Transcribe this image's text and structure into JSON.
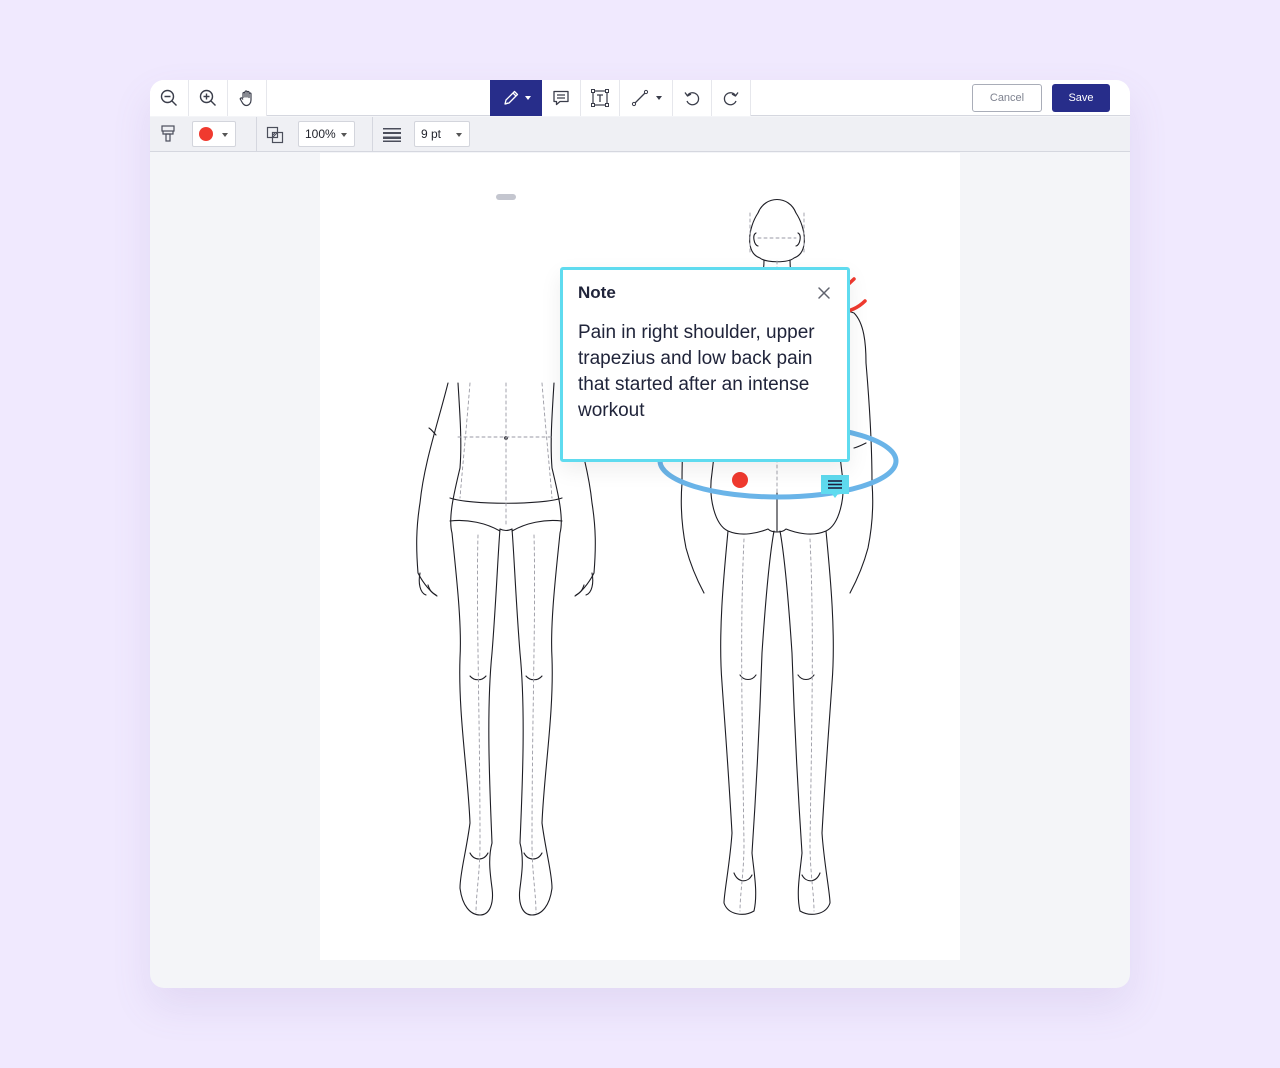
{
  "toolbar": {
    "zoom_out_icon": "zoom-out-icon",
    "zoom_in_icon": "zoom-in-icon",
    "pan_icon": "hand-icon",
    "pen_icon": "pen-icon",
    "comment_icon": "comment-icon",
    "text_box_icon": "text-box-icon",
    "line_icon": "line-icon",
    "undo_icon": "undo-icon",
    "redo_icon": "redo-icon",
    "cancel_label": "Cancel",
    "save_label": "Save"
  },
  "format_bar": {
    "stroke_color": "#f03a2f",
    "zoom_value": "100%",
    "line_weight_value": "9 pt"
  },
  "note": {
    "title": "Note",
    "body": "Pain in right shoulder, upper trapezius and low back pain that started after an intense workout"
  },
  "colors": {
    "accent": "#272d8a",
    "note_border": "#5fdbef",
    "annotation_red": "#f03a2f",
    "annotation_blue": "#6ab4e8",
    "background": "#f0e9fe"
  }
}
